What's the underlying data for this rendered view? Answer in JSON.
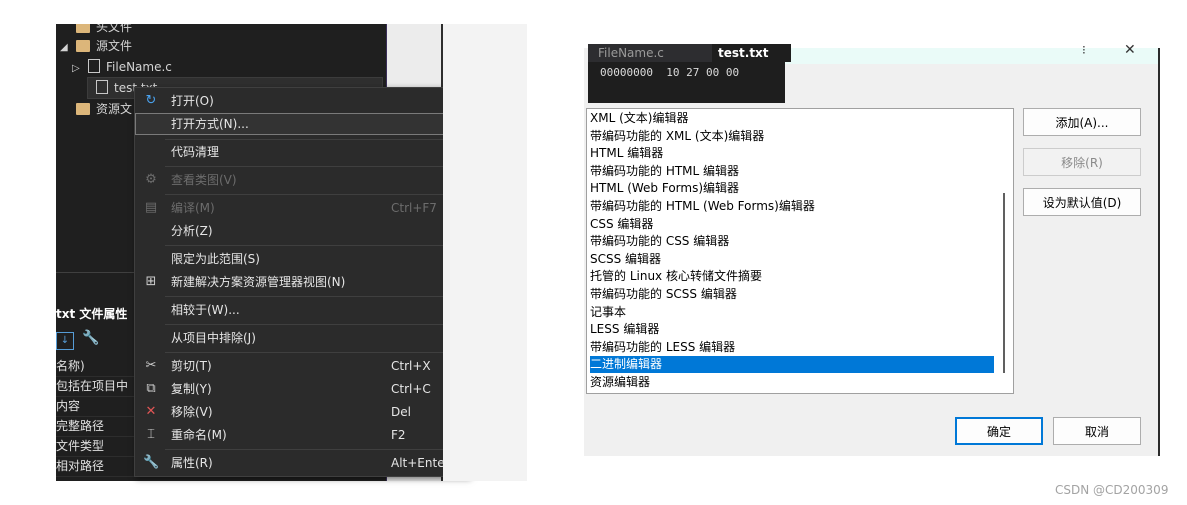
{
  "solution_tree": {
    "items": [
      {
        "label": "头文件",
        "kind": "folder"
      },
      {
        "label": "源文件",
        "kind": "folder"
      },
      {
        "label": "FileName.c",
        "kind": "file"
      },
      {
        "label": "test.txt",
        "kind": "file"
      },
      {
        "label": "资源文",
        "kind": "folder"
      }
    ]
  },
  "properties": {
    "title": "txt 文件属性",
    "rows": [
      "名称)",
      "包括在项目中",
      "内容",
      "完整路径",
      "文件类型",
      "相对路径"
    ]
  },
  "context_menu": {
    "items": [
      {
        "label": "打开(O)",
        "shortcut": "",
        "icon": "open-icon",
        "disabled": false
      },
      {
        "label": "打开方式(N)...",
        "shortcut": "",
        "icon": "",
        "disabled": false
      },
      {
        "label": "代码清理",
        "shortcut": "",
        "icon": "",
        "disabled": false,
        "submenu": true
      },
      {
        "label": "查看类图(V)",
        "shortcut": "",
        "icon": "class-diagram-icon",
        "disabled": true
      },
      {
        "label": "编译(M)",
        "shortcut": "Ctrl+F7",
        "icon": "compile-icon",
        "disabled": true
      },
      {
        "label": "分析(Z)",
        "shortcut": "",
        "icon": "",
        "disabled": false,
        "submenu": true
      },
      {
        "label": "限定为此范围(S)",
        "shortcut": "",
        "icon": "",
        "disabled": false
      },
      {
        "label": "新建解决方案资源管理器视图(N)",
        "shortcut": "",
        "icon": "new-view-icon",
        "disabled": false
      },
      {
        "label": "相较于(W)...",
        "shortcut": "",
        "icon": "",
        "disabled": false
      },
      {
        "label": "从项目中排除(J)",
        "shortcut": "",
        "icon": "",
        "disabled": false
      },
      {
        "label": "剪切(T)",
        "shortcut": "Ctrl+X",
        "icon": "cut-icon",
        "disabled": false
      },
      {
        "label": "复制(Y)",
        "shortcut": "Ctrl+C",
        "icon": "copy-icon",
        "disabled": false
      },
      {
        "label": "移除(V)",
        "shortcut": "Del",
        "icon": "delete-icon",
        "disabled": false
      },
      {
        "label": "重命名(M)",
        "shortcut": "F2",
        "icon": "rename-icon",
        "disabled": false
      },
      {
        "label": "属性(R)",
        "shortcut": "Alt+Enter",
        "icon": "wrench-icon",
        "disabled": false
      }
    ]
  },
  "hex_editor": {
    "tabs": [
      "FileName.c",
      "test.txt"
    ],
    "line": "00000000  10 27 00 00"
  },
  "open_with_dialog": {
    "editors": [
      "XML (文本)编辑器",
      "带编码功能的 XML (文本)编辑器",
      "HTML 编辑器",
      "带编码功能的 HTML 编辑器",
      "HTML (Web Forms)编辑器",
      "带编码功能的 HTML (Web Forms)编辑器",
      "CSS 编辑器",
      "带编码功能的 CSS 编辑器",
      "SCSS 编辑器",
      "托管的 Linux 核心转储文件摘要",
      "带编码功能的 SCSS 编辑器",
      "记事本",
      "LESS 编辑器",
      "带编码功能的 LESS 编辑器",
      "二进制编辑器",
      "资源编辑器"
    ],
    "selected": "二进制编辑器",
    "buttons": {
      "add": "添加(A)...",
      "remove": "移除(R)",
      "set_default": "设为默认值(D)",
      "ok": "确定",
      "cancel": "取消"
    }
  },
  "watermark": "CSDN @CD200309",
  "colors": {
    "selection": "#0078d7",
    "menu_bg": "#2b2b2b",
    "folder": "#dcb67a"
  }
}
